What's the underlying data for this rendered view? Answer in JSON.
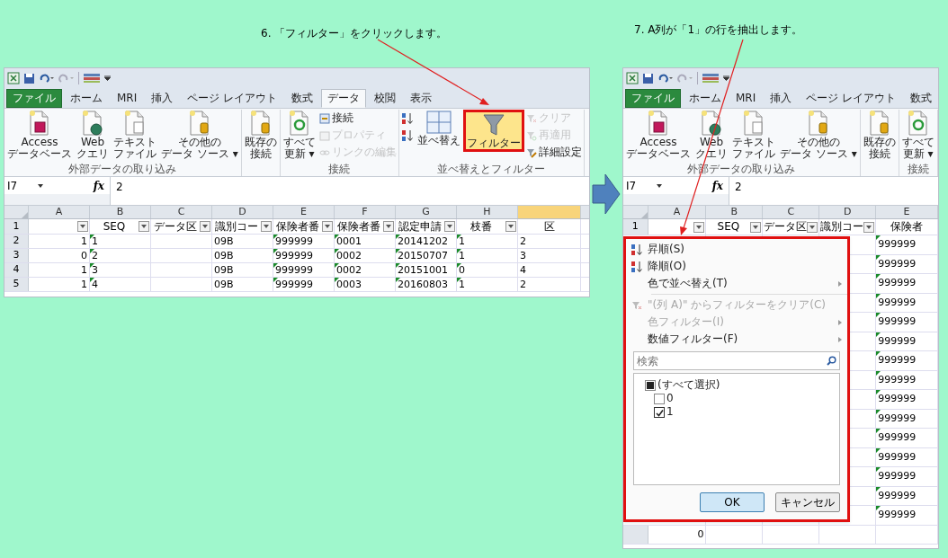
{
  "steps": [
    {
      "caption": "6. 「フィルター」をクリックします。",
      "window": {
        "tabs": [
          {
            "label": "ファイル",
            "kind": "file",
            "selected": false
          },
          {
            "label": "ホーム",
            "kind": "tab",
            "selected": false
          },
          {
            "label": "MRI",
            "kind": "tab",
            "selected": false
          },
          {
            "label": "挿入",
            "kind": "tab",
            "selected": false
          },
          {
            "label": "ページ レイアウト",
            "kind": "tab",
            "selected": false
          },
          {
            "label": "数式",
            "kind": "tab",
            "selected": false
          },
          {
            "label": "データ",
            "kind": "tab",
            "selected": true
          },
          {
            "label": "校閲",
            "kind": "tab",
            "selected": false
          },
          {
            "label": "表示",
            "kind": "tab",
            "selected": false
          }
        ],
        "ribbon_groups": [
          {
            "label": "外部データの取り込み",
            "controls": [
              {
                "kind": "access",
                "lines": [
                  "Access",
                  "データベース"
                ],
                "disabled": false,
                "active": false,
                "highlighted": false
              },
              {
                "kind": "web",
                "lines": [
                  "Web",
                  "クエリ"
                ],
                "disabled": false,
                "active": false,
                "highlighted": false
              },
              {
                "kind": "text",
                "lines": [
                  "テキスト",
                  "ファイル"
                ],
                "disabled": false,
                "active": false,
                "highlighted": false
              },
              {
                "kind": "other",
                "lines": [
                  "その他の",
                  "データ ソース ▾"
                ],
                "disabled": false,
                "active": false,
                "highlighted": false
              }
            ]
          },
          {
            "controls": [
              {
                "kind": "existing",
                "lines": [
                  "既存の",
                  "接続"
                ],
                "disabled": false,
                "active": false,
                "highlighted": false
              }
            ]
          },
          {
            "label": "接続",
            "controls": [
              {
                "kind": "refresh",
                "lines": [
                  "すべて",
                  "更新 ▾"
                ],
                "disabled": false,
                "active": false,
                "highlighted": false
              },
              {
                "kind": "connections",
                "lines": [
                  "接続"
                ],
                "disabled": false,
                "active": false,
                "highlighted": false
              },
              {
                "kind": "properties",
                "lines": [
                  "プロパティ"
                ],
                "disabled": true,
                "active": false,
                "highlighted": false
              },
              {
                "kind": "links",
                "lines": [
                  "リンクの編集"
                ],
                "disabled": true,
                "active": false,
                "highlighted": false
              }
            ]
          },
          {
            "label": "並べ替えとフィルター",
            "controls": [
              {
                "kind": "sort_asc",
                "disabled": false,
                "active": false,
                "highlighted": false
              },
              {
                "kind": "sort_desc",
                "disabled": false,
                "active": false,
                "highlighted": false
              },
              {
                "kind": "sort",
                "lines": [
                  "並べ替え"
                ],
                "disabled": false,
                "active": false,
                "highlighted": false
              },
              {
                "kind": "filter",
                "lines": [
                  "フィルター"
                ],
                "disabled": false,
                "active": true,
                "highlighted": true
              },
              {
                "kind": "clear",
                "lines": [
                  "クリア"
                ],
                "disabled": true,
                "active": false,
                "highlighted": false
              },
              {
                "kind": "reapply",
                "lines": [
                  "再適用"
                ],
                "disabled": true,
                "active": false,
                "highlighted": false
              },
              {
                "kind": "advanced",
                "lines": [
                  "詳細設定"
                ],
                "disabled": false,
                "active": false,
                "highlighted": false
              }
            ]
          }
        ],
        "name_box": "I7",
        "fx_label": "fx",
        "formula": "2",
        "columns": [
          {
            "letter": "A",
            "green_marks": false,
            "selected": false
          },
          {
            "letter": "B",
            "green_marks": true,
            "selected": false
          },
          {
            "letter": "C",
            "green_marks": false,
            "selected": false
          },
          {
            "letter": "D",
            "green_marks": false,
            "selected": false
          },
          {
            "letter": "E",
            "green_marks": true,
            "selected": false
          },
          {
            "letter": "F",
            "green_marks": true,
            "selected": false
          },
          {
            "letter": "G",
            "green_marks": true,
            "selected": false
          },
          {
            "letter": "H",
            "green_marks": true,
            "selected": false
          },
          {
            "green_marks": false,
            "selected": true
          }
        ],
        "header_row": {
          "number": "1",
          "cells": [
            {
              "filter": true
            },
            {
              "text": "SEQ",
              "filter": true
            },
            {
              "text": "データ区",
              "filter": true
            },
            {
              "text": "識別コー",
              "filter": true
            },
            {
              "text": "保険者番",
              "filter": true
            },
            {
              "text": "保険者番",
              "filter": true
            },
            {
              "text": "認定申請",
              "filter": true
            },
            {
              "text": "枝番",
              "filter": true
            },
            {
              "text": "区",
              "filter": false
            }
          ]
        },
        "rows": [
          {
            "number": "2",
            "cells": [
              "1",
              "1",
              null,
              "09B",
              "999999",
              "0001",
              "20141202",
              "1",
              "2"
            ]
          },
          {
            "number": "3",
            "cells": [
              "0",
              "2",
              null,
              "09B",
              "999999",
              "0002",
              "20150707",
              "1",
              "3"
            ]
          },
          {
            "number": "4",
            "cells": [
              "1",
              "3",
              null,
              "09B",
              "999999",
              "0002",
              "20151001",
              "0",
              "4"
            ]
          },
          {
            "number": "5",
            "cells": [
              "1",
              "4",
              null,
              "09B",
              "999999",
              "0003",
              "20160803",
              "1",
              "2"
            ]
          }
        ]
      }
    },
    {
      "caption": "7. A列が「1」の行を抽出します。",
      "window": {
        "tabs": [
          {
            "label": "ファイル",
            "kind": "file",
            "selected": false
          },
          {
            "label": "ホーム",
            "kind": "tab",
            "selected": false
          },
          {
            "label": "MRI",
            "kind": "tab",
            "selected": false
          },
          {
            "label": "挿入",
            "kind": "tab",
            "selected": false
          },
          {
            "label": "ページ レイアウト",
            "kind": "tab",
            "selected": false
          },
          {
            "label": "数式",
            "kind": "tab",
            "selected": false
          }
        ],
        "ribbon_groups": [
          {
            "label": "外部データの取り込み",
            "controls": [
              {
                "kind": "access",
                "lines": [
                  "Access",
                  "データベース"
                ],
                "disabled": false,
                "active": false,
                "highlighted": false
              },
              {
                "kind": "web",
                "lines": [
                  "Web",
                  "クエリ"
                ],
                "disabled": false,
                "active": false,
                "highlighted": false
              },
              {
                "kind": "text",
                "lines": [
                  "テキスト",
                  "ファイル"
                ],
                "disabled": false,
                "active": false,
                "highlighted": false
              },
              {
                "kind": "other",
                "lines": [
                  "その他の",
                  "データ ソース ▾"
                ],
                "disabled": false,
                "active": false,
                "highlighted": false
              }
            ]
          },
          {
            "controls": [
              {
                "kind": "existing",
                "lines": [
                  "既存の",
                  "接続"
                ],
                "disabled": false,
                "active": false,
                "highlighted": false
              }
            ]
          },
          {
            "label": "接続",
            "controls": [
              {
                "kind": "refresh",
                "lines": [
                  "すべて",
                  "更新 ▾"
                ],
                "disabled": false,
                "active": false,
                "highlighted": false
              }
            ]
          }
        ],
        "name_box": "I7",
        "fx_label": "fx",
        "formula": "2",
        "columns": [
          {
            "letter": "A",
            "green_marks": false,
            "selected": false
          },
          {
            "letter": "B",
            "green_marks": false,
            "selected": false
          },
          {
            "letter": "C",
            "green_marks": false,
            "selected": false
          },
          {
            "letter": "D",
            "green_marks": false,
            "selected": false
          },
          {
            "letter": "E",
            "green_marks": true,
            "selected": false
          }
        ],
        "header_row": {
          "number": "1",
          "cells": [
            {
              "filter": true
            },
            {
              "text": "SEQ",
              "filter": true
            },
            {
              "text": "データ区",
              "filter": true
            },
            {
              "text": "識別コー",
              "filter": true
            },
            {
              "text": "保険者",
              "filter": false
            }
          ]
        },
        "rows": [
          {
            "cells": [
              null,
              null,
              null,
              null,
              "999999"
            ]
          },
          {
            "cells": [
              null,
              null,
              null,
              null,
              "999999"
            ]
          },
          {
            "cells": [
              null,
              null,
              null,
              null,
              "999999"
            ]
          },
          {
            "cells": [
              null,
              null,
              null,
              null,
              "999999"
            ]
          },
          {
            "cells": [
              null,
              null,
              null,
              null,
              "999999"
            ]
          },
          {
            "cells": [
              null,
              null,
              null,
              null,
              "999999"
            ]
          },
          {
            "cells": [
              null,
              null,
              null,
              null,
              "999999"
            ]
          },
          {
            "cells": [
              null,
              null,
              null,
              null,
              "999999"
            ]
          },
          {
            "cells": [
              null,
              null,
              null,
              null,
              "999999"
            ]
          },
          {
            "cells": [
              null,
              null,
              null,
              null,
              "999999"
            ]
          },
          {
            "cells": [
              null,
              null,
              null,
              null,
              "999999"
            ]
          },
          {
            "cells": [
              null,
              null,
              null,
              null,
              "999999"
            ]
          },
          {
            "cells": [
              null,
              null,
              null,
              null,
              "999999"
            ]
          },
          {
            "cells": [
              null,
              null,
              null,
              null,
              "999999"
            ]
          },
          {
            "cells": [
              null,
              null,
              null,
              null,
              "999999"
            ]
          },
          {
            "cells": [
              "0",
              null,
              null,
              null,
              null
            ]
          }
        ],
        "filter_menu": {
          "highlighted": true,
          "items": [
            {
              "kind": "sort_asc",
              "label": "昇順(S)",
              "disabled": false
            },
            {
              "kind": "sort_desc",
              "label": "降順(O)",
              "disabled": false
            },
            {
              "kind": "submenu",
              "label": "色で並べ替え(T)",
              "disabled": false
            },
            {
              "kind": "separator"
            },
            {
              "kind": "clear_filter",
              "label": "\"(列 A)\" からフィルターをクリア(C)",
              "disabled": true
            },
            {
              "kind": "submenu",
              "label": "色フィルター(I)",
              "disabled": true
            },
            {
              "kind": "submenu",
              "label": "数値フィルター(F)",
              "disabled": false
            }
          ],
          "search": {
            "placeholder": "検索"
          },
          "values": [
            {
              "label": "(すべて選択)",
              "checked": false,
              "indeterminate": true,
              "children": [
                {
                  "label": "0",
                  "checked": false,
                  "indeterminate": false
                },
                {
                  "label": "1",
                  "checked": true,
                  "indeterminate": false
                }
              ]
            }
          ],
          "buttons": [
            {
              "label": "OK",
              "default": true
            },
            {
              "label": "キャンセル",
              "default": false
            }
          ]
        }
      }
    }
  ]
}
